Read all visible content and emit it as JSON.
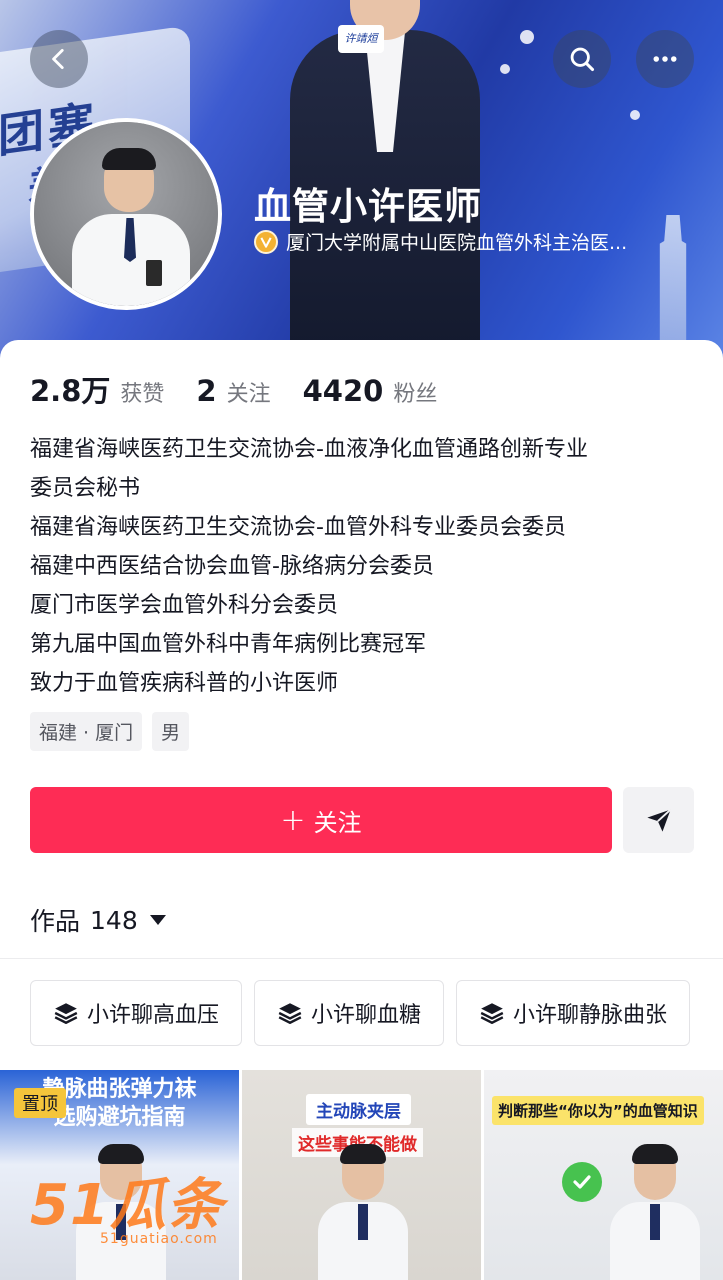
{
  "header": {
    "back_icon": "chevron-left-icon",
    "search_icon": "search-icon",
    "more_icon": "more-horizontal-icon",
    "banner_text_1": "团塞",
    "banner_text_2": "差",
    "mic_label": "许靖烜"
  },
  "profile": {
    "name": "血管小许医师",
    "verification": "厦门大学附属中山医院血管外科主治医...",
    "verified_color": "#f3b233"
  },
  "stats": {
    "likes_value": "2.8万",
    "likes_label": "获赞",
    "following_value": "2",
    "following_label": "关注",
    "followers_value": "4420",
    "followers_label": "粉丝"
  },
  "bio": [
    "福建省海峡医药卫生交流协会-血液净化血管通路创新专业",
    "委员会秘书",
    "福建省海峡医药卫生交流协会-血管外科专业委员会委员",
    "福建中西医结合协会血管-脉络病分会委员",
    "厦门市医学会血管外科分会委员",
    "第九届中国血管外科中青年病例比赛冠军",
    "致力于血管疾病科普的小许医师"
  ],
  "tags": [
    "福建 · 厦门",
    "男"
  ],
  "actions": {
    "follow_label": "关注",
    "follow_color": "#fe2c55",
    "message_icon": "send-icon"
  },
  "works": {
    "label": "作品",
    "count": "148"
  },
  "collections": [
    {
      "label": "小许聊高血压",
      "icon": "layers-icon"
    },
    {
      "label": "小许聊血糖",
      "icon": "layers-icon"
    },
    {
      "label": "小许聊静脉曲张",
      "icon": "layers-icon"
    }
  ],
  "videos": [
    {
      "pinned": "置顶",
      "title_1": "静脉曲张弹力袜",
      "title_2": "选购避坑指南"
    },
    {
      "caption_1": "主动脉夹层",
      "caption_2": "这些事能不能做"
    },
    {
      "caption_1": "判断那些“你以为”的血管知识"
    }
  ],
  "watermark": {
    "text": "51瓜条",
    "sub": "51guatiao.com"
  }
}
